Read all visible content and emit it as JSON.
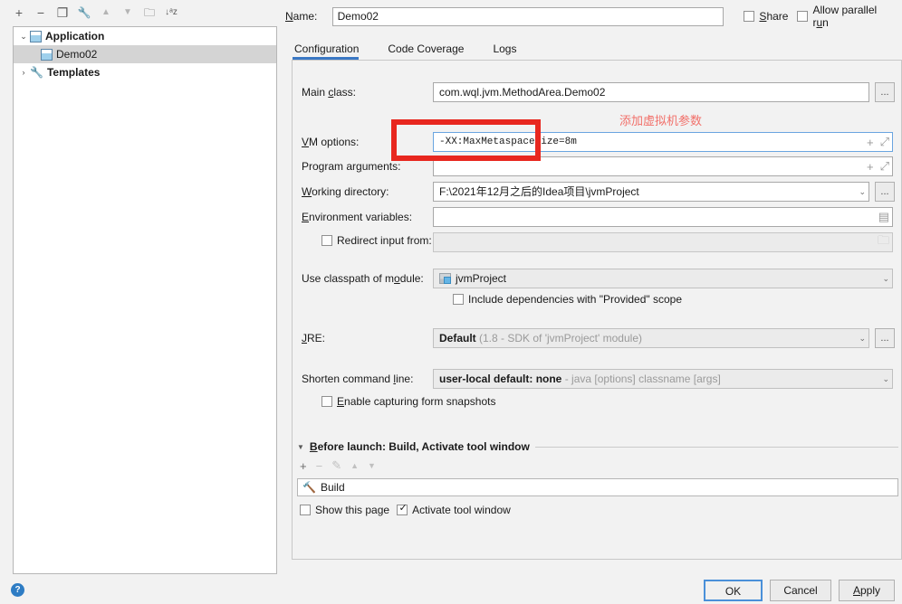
{
  "sidebar": {
    "toolbar": [
      {
        "name": "add-icon",
        "glyph": "+",
        "dim": false
      },
      {
        "name": "remove-icon",
        "glyph": "−",
        "dim": false
      },
      {
        "name": "copy-icon",
        "glyph": "❐",
        "dim": false
      },
      {
        "name": "wrench-icon",
        "glyph": "🔧",
        "dim": false
      },
      {
        "name": "move-up-icon",
        "glyph": "▲",
        "dim": true
      },
      {
        "name": "move-down-icon",
        "glyph": "▼",
        "dim": true
      },
      {
        "name": "new-folder-icon",
        "glyph": "🗀",
        "dim": false
      },
      {
        "name": "sort-alphabetically-icon",
        "glyph": "↓ᵃz",
        "dim": false
      }
    ],
    "tree": [
      {
        "label": "Application",
        "chevron": "⌄",
        "icon": "application-icon",
        "bold": true,
        "selected": false,
        "indent": false
      },
      {
        "label": "Demo02",
        "chevron": "",
        "icon": "application-icon",
        "bold": false,
        "selected": true,
        "indent": true
      },
      {
        "label": "Templates",
        "chevron": "›",
        "icon": "wrench-icon",
        "bold": true,
        "selected": false,
        "indent": false
      }
    ]
  },
  "header": {
    "name_label": "Name:",
    "name_value": "Demo02",
    "share_label": "Share",
    "share_checked": false,
    "parallel_label": "Allow parallel run",
    "parallel_checked": false
  },
  "tabs": [
    {
      "label": "Configuration",
      "active": true
    },
    {
      "label": "Code Coverage",
      "active": false
    },
    {
      "label": "Logs",
      "active": false
    }
  ],
  "form": {
    "main_class_label": "Main class:",
    "main_class_value": "com.wql.jvm.MethodArea.Demo02",
    "vm_options_label": "VM options:",
    "vm_options_value": "-XX:MaxMetaspaceSize=8m",
    "program_arguments_label": "Program arguments:",
    "program_arguments_value": "",
    "working_directory_label": "Working directory:",
    "working_directory_value": "F:\\2021年12月之后的Idea项目\\jvmProject",
    "environment_variables_label": "Environment variables:",
    "environment_variables_value": "",
    "redirect_input_label": "Redirect input from:",
    "redirect_input_checked": false,
    "redirect_input_value": "",
    "classpath_module_label": "Use classpath of module:",
    "classpath_module_value": "jvmProject",
    "include_provided_label": "Include dependencies with \"Provided\" scope",
    "include_provided_checked": false,
    "jre_label": "JRE:",
    "jre_value": "Default",
    "jre_hint": "(1.8 - SDK of 'jvmProject' module)",
    "shorten_label": "Shorten command line:",
    "shorten_value": "user-local default: none",
    "shorten_hint": "- java [options] classname [args]",
    "snapshots_label": "Enable capturing form snapshots",
    "snapshots_checked": false,
    "ellipsis_button": "...",
    "expand_icon": "⤢",
    "plus_icon": "+",
    "dropdown_icon": "⌄",
    "env_list_icon": "▤",
    "folder_icon": "🗀"
  },
  "before_launch": {
    "header": "Before launch: Build, Activate tool window",
    "collapse_icon": "▼",
    "toolbar": [
      {
        "name": "add-task-icon",
        "glyph": "+",
        "dim": false
      },
      {
        "name": "remove-task-icon",
        "glyph": "−",
        "dim": true
      },
      {
        "name": "edit-task-icon",
        "glyph": "✎",
        "dim": true
      },
      {
        "name": "move-task-up-icon",
        "glyph": "▲",
        "dim": true
      },
      {
        "name": "move-task-down-icon",
        "glyph": "▼",
        "dim": true
      }
    ],
    "task_icon": "🔨",
    "task_label": "Build",
    "show_page_label": "Show this page",
    "show_page_checked": false,
    "activate_window_label": "Activate tool window",
    "activate_window_checked": true
  },
  "annotation": {
    "text": "添加虚拟机参数",
    "color": "#e8271f"
  },
  "footer": {
    "help_icon": "?",
    "ok_label": "OK",
    "cancel_label": "Cancel",
    "apply_label": "Apply"
  }
}
